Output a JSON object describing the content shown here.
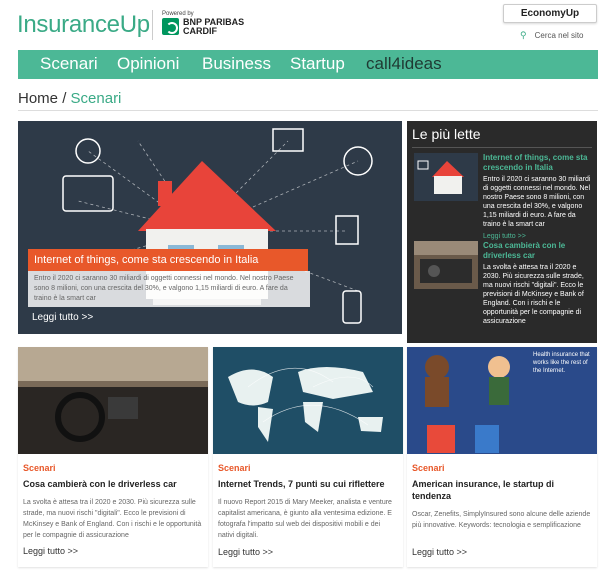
{
  "header": {
    "logo": "InsuranceUp",
    "powered": "Powered by",
    "partner_line1": "BNP PARIBAS",
    "partner_line2": "CARDIF",
    "economy": "EconomyUp",
    "search_label": "Cerca nel sito"
  },
  "nav": {
    "items": [
      "Scenari",
      "Opinioni",
      "Business",
      "Startup",
      "call4ideas"
    ]
  },
  "breadcrumb": {
    "home": "Home",
    "sep": "/",
    "current": "Scenari"
  },
  "hero": {
    "title": "Internet of things, come sta crescendo in Italia",
    "text": "Entro il 2020 ci saranno 30 miliardi di oggetti connessi nel mondo. Nel nostro Paese sono 8 milioni, con una crescita del 30%, e valgono 1,15 miliardi di euro. A fare da traino è la smart car",
    "more": "Leggi tutto >>"
  },
  "sidebar": {
    "title": "Le più lette",
    "items": [
      {
        "title": "Internet of things, come sta crescendo in Italia",
        "text": "Entro il 2020 ci saranno 30 miliardi di oggetti connessi nel mondo. Nel nostro Paese sono 8 milioni, con una crescita del 30%, e valgono 1,15 miliardi di euro. A fare da traino è la smart car",
        "more": "Leggi tutto >>"
      },
      {
        "title": "Cosa cambierà con le driverless car",
        "text": "La svolta è attesa tra il 2020 e 2030. Più sicurezza sulle strade, ma nuovi rischi \"digitali\". Ecco le previsioni di McKinsey e Bank of England. Con i rischi e le opportunità per le compagnie di assicurazione",
        "more": ""
      }
    ]
  },
  "cards": [
    {
      "category": "Scenari",
      "title": "Cosa cambierà con le driverless car",
      "text": "La svolta è attesa tra il 2020 e 2030. Più sicurezza sulle strade, ma nuovi rischi \"digitali\". Ecco le previsioni di McKinsey e Bank of England. Con i rischi e le opportunità per le compagnie di assicurazione",
      "more": "Leggi tutto >>"
    },
    {
      "category": "Scenari",
      "title": "Internet Trends, 7 punti su cui riflettere",
      "text": "Il nuovo Report 2015 di Mary Meeker, analista e venture capitalist americana, è giunto alla ventesima edizione. E fotografa l'impatto sul web dei dispositivi mobili e dei nativi digitali.",
      "more": "Leggi tutto >>"
    },
    {
      "category": "Scenari",
      "title": "American insurance, le startup di tendenza",
      "text": "Oscar, Zenefits, SimplyInsured sono alcune delle aziende più innovative. Keywords: tecnologia e semplificazione",
      "more": "Leggi tutto >>",
      "image_text": "Health insurance that works like the rest of the Internet."
    }
  ],
  "colors": {
    "accent": "#4cb896",
    "orange": "#e8582a",
    "dark": "#2a2a2a"
  }
}
